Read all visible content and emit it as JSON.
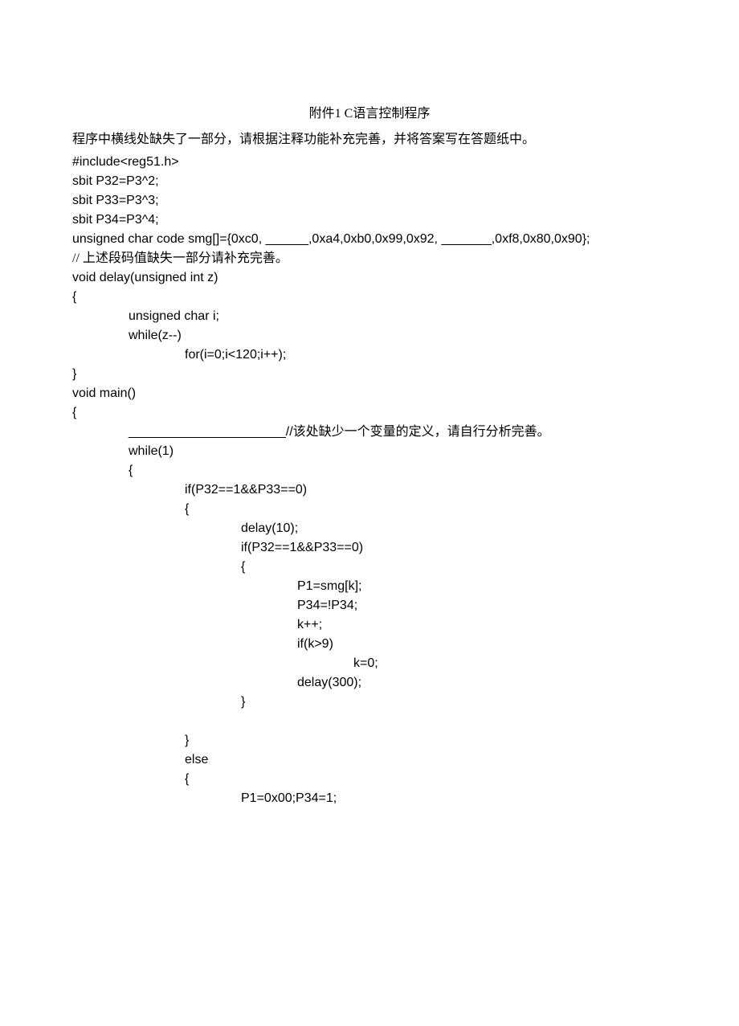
{
  "title": "附件1 C语言控制程序",
  "instruction": "程序中横线处缺失了一部分，请根据注释功能补充完善，并将答案写在答题纸中。",
  "lines": [
    {
      "cls": "code",
      "text": "#include<reg51.h>"
    },
    {
      "cls": "code",
      "text": "sbit P32=P3^2;"
    },
    {
      "cls": "code",
      "text": "sbit P33=P3^3;"
    },
    {
      "cls": "code",
      "text": "sbit P34=P3^4;"
    },
    {
      "cls": "code",
      "text": "unsigned char code smg[]={0xc0, ______,0xa4,0xb0,0x99,0x92, _______,0xf8,0x80,0x90};"
    },
    {
      "cls": "code comment",
      "text": "// 上述段码值缺失一部分请补充完善。"
    },
    {
      "cls": "code",
      "text": "void delay(unsigned int z)"
    },
    {
      "cls": "code",
      "text": "{"
    },
    {
      "cls": "code indent1",
      "text": "unsigned char i;"
    },
    {
      "cls": "code indent1",
      "text": "while(z--)"
    },
    {
      "cls": "code indent2",
      "text": "for(i=0;i<120;i++);"
    },
    {
      "cls": "code",
      "text": "}"
    },
    {
      "cls": "code",
      "text": "void main()"
    },
    {
      "cls": "code",
      "text": "{"
    },
    {
      "cls": "code indent1",
      "text": "______________________//该处缺少一个变量的定义，请自行分析完善。"
    },
    {
      "cls": "code indent1",
      "text": "while(1)"
    },
    {
      "cls": "code indent1",
      "text": "{"
    },
    {
      "cls": "code indent2",
      "text": "if(P32==1&&P33==0)"
    },
    {
      "cls": "code indent2",
      "text": "{"
    },
    {
      "cls": "code indent3",
      "text": "delay(10);"
    },
    {
      "cls": "code indent3",
      "text": "if(P32==1&&P33==0)"
    },
    {
      "cls": "code indent3",
      "text": "{"
    },
    {
      "cls": "code indent4",
      "text": "P1=smg[k];"
    },
    {
      "cls": "code indent4",
      "text": "P34=!P34;"
    },
    {
      "cls": "code indent4",
      "text": "k++;"
    },
    {
      "cls": "code indent4",
      "text": "if(k>9)"
    },
    {
      "cls": "code indent5",
      "text": "k=0;"
    },
    {
      "cls": "code indent4",
      "text": "delay(300);"
    },
    {
      "cls": "code indent3",
      "text": "}"
    },
    {
      "cls": "code indent3",
      "text": " "
    },
    {
      "cls": "code indent2",
      "text": "}"
    },
    {
      "cls": "code indent2",
      "text": "else"
    },
    {
      "cls": "code indent2",
      "text": "{"
    },
    {
      "cls": "code indent3",
      "text": "P1=0x00;P34=1;"
    }
  ]
}
